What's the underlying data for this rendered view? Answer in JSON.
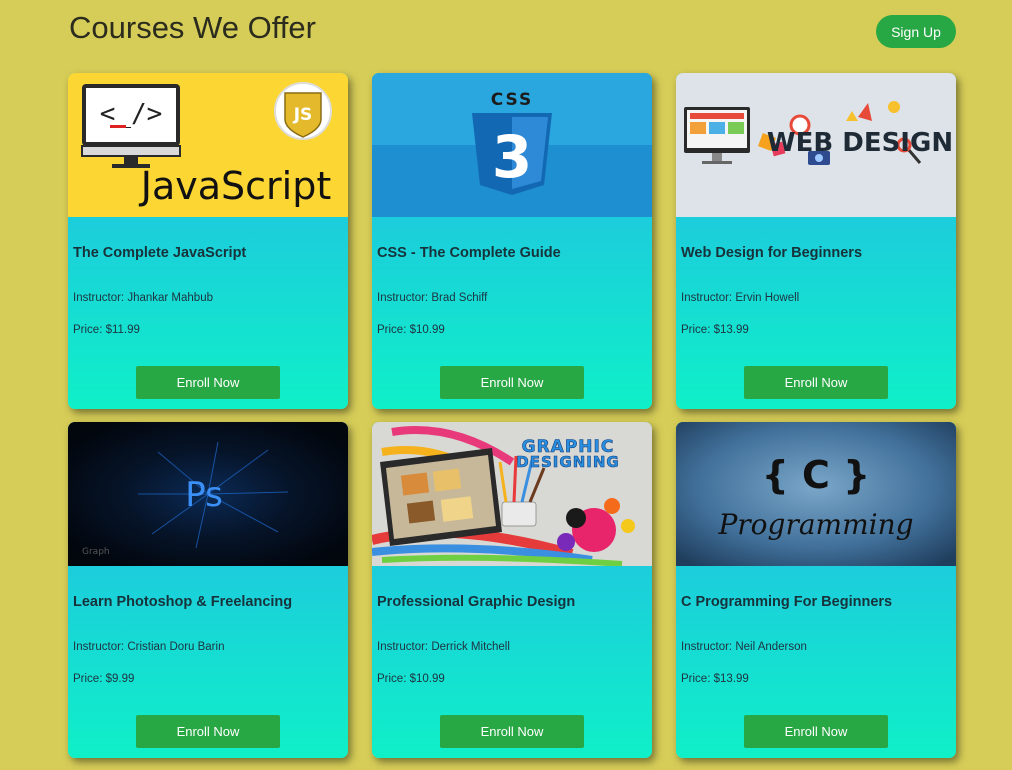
{
  "header": {
    "title": "Courses We Offer",
    "signup_label": "Sign Up"
  },
  "courses": [
    {
      "title": "The Complete JavaScript",
      "instructor": "Instructor: Jhankar Mahbub",
      "price": "Price: $11.99",
      "enroll_label": "Enroll Now",
      "thumb": {
        "icon": "javascript-logo",
        "text": "JavaScript",
        "badge": "JS",
        "code": "<_/>"
      }
    },
    {
      "title": "CSS - The Complete Guide",
      "instructor": "Instructor: Brad Schiff",
      "price": "Price: $10.99",
      "enroll_label": "Enroll Now",
      "thumb": {
        "icon": "css3-shield",
        "text": "CSS",
        "badge": "3"
      }
    },
    {
      "title": "Web Design for Beginners",
      "instructor": "Instructor: Ervin Howell",
      "price": "Price: $13.99",
      "enroll_label": "Enroll Now",
      "thumb": {
        "icon": "web-design-illustration",
        "text": "WEB DESIGN"
      }
    },
    {
      "title": "Learn Photoshop & Freelancing",
      "instructor": "Instructor: Cristian Doru Barin",
      "price": "Price: $9.99",
      "enroll_label": "Enroll Now",
      "thumb": {
        "icon": "photoshop-logo",
        "text": "Ps",
        "sub": "Graph"
      }
    },
    {
      "title": "Professional Graphic Design",
      "instructor": "Instructor: Derrick Mitchell",
      "price": "Price: $10.99",
      "enroll_label": "Enroll Now",
      "thumb": {
        "icon": "graphic-design-illustration",
        "text": "GRAPHIC",
        "text2": "DESIGNING"
      }
    },
    {
      "title": "C Programming For Beginners",
      "instructor": "Instructor: Neil Anderson",
      "price": "Price: $13.99",
      "enroll_label": "Enroll Now",
      "thumb": {
        "icon": "c-programming-logo",
        "text": "{ C }",
        "text2": "Programming"
      }
    }
  ],
  "colors": {
    "background": "#d6cd58",
    "button": "#28a745",
    "card_top": "#23bce3",
    "card_bottom": "#0ff0c8"
  }
}
